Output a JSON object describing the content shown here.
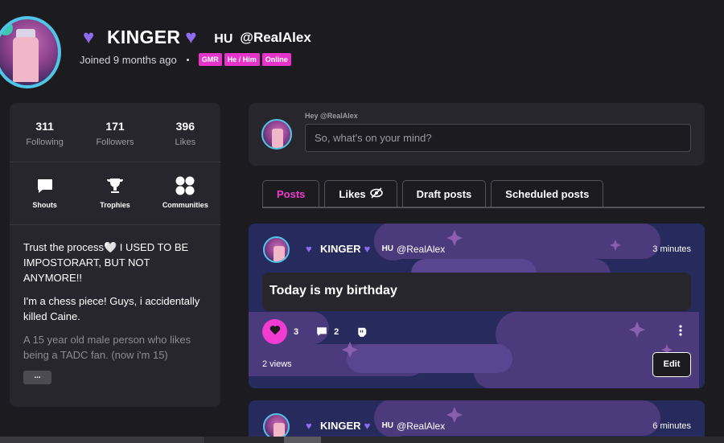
{
  "profile": {
    "display_name": "KINGER",
    "region_tag": "HU",
    "handle": "@RealAlex",
    "joined": "Joined 9 months ago",
    "badges": [
      "GMR",
      "He / Him",
      "Online"
    ],
    "badge_color": "#e633c9",
    "heart_color": "#8e6cf0"
  },
  "stats": [
    {
      "value": "311",
      "label": "Following"
    },
    {
      "value": "171",
      "label": "Followers"
    },
    {
      "value": "396",
      "label": "Likes"
    }
  ],
  "shortcuts": [
    {
      "label": "Shouts",
      "icon": "chat-bubble-icon"
    },
    {
      "label": "Trophies",
      "icon": "trophy-icon"
    },
    {
      "label": "Communities",
      "icon": "communities-icon"
    }
  ],
  "bio": {
    "line1": "Trust the process🤍 I USED TO BE IMPOSTORART, BUT NOT ANYMORE!!",
    "line2": "I'm a chess piece! Guys, i accidentally killed Caine.",
    "line3": "A 15 year old male person who likes being a TADC fan. (now i'm 15)",
    "more_label": "..."
  },
  "compose": {
    "hint": "Hey @RealAlex",
    "placeholder": "So, what's on your mind?"
  },
  "tabs": [
    {
      "label": "Posts",
      "active": true
    },
    {
      "label": "Likes",
      "active": false
    },
    {
      "label": "Draft posts",
      "active": false
    },
    {
      "label": "Scheduled posts",
      "active": false
    }
  ],
  "accent_color": "#f23bd1",
  "posts": [
    {
      "author": "KINGER",
      "region_tag": "HU",
      "handle": "@RealAlex",
      "time": "3 minutes",
      "body": "Today is my birthday",
      "likes": "3",
      "comments": "2",
      "views": "2 views",
      "edit_label": "Edit"
    },
    {
      "author": "KINGER",
      "region_tag": "HU",
      "handle": "@RealAlex",
      "time": "6 minutes"
    }
  ]
}
